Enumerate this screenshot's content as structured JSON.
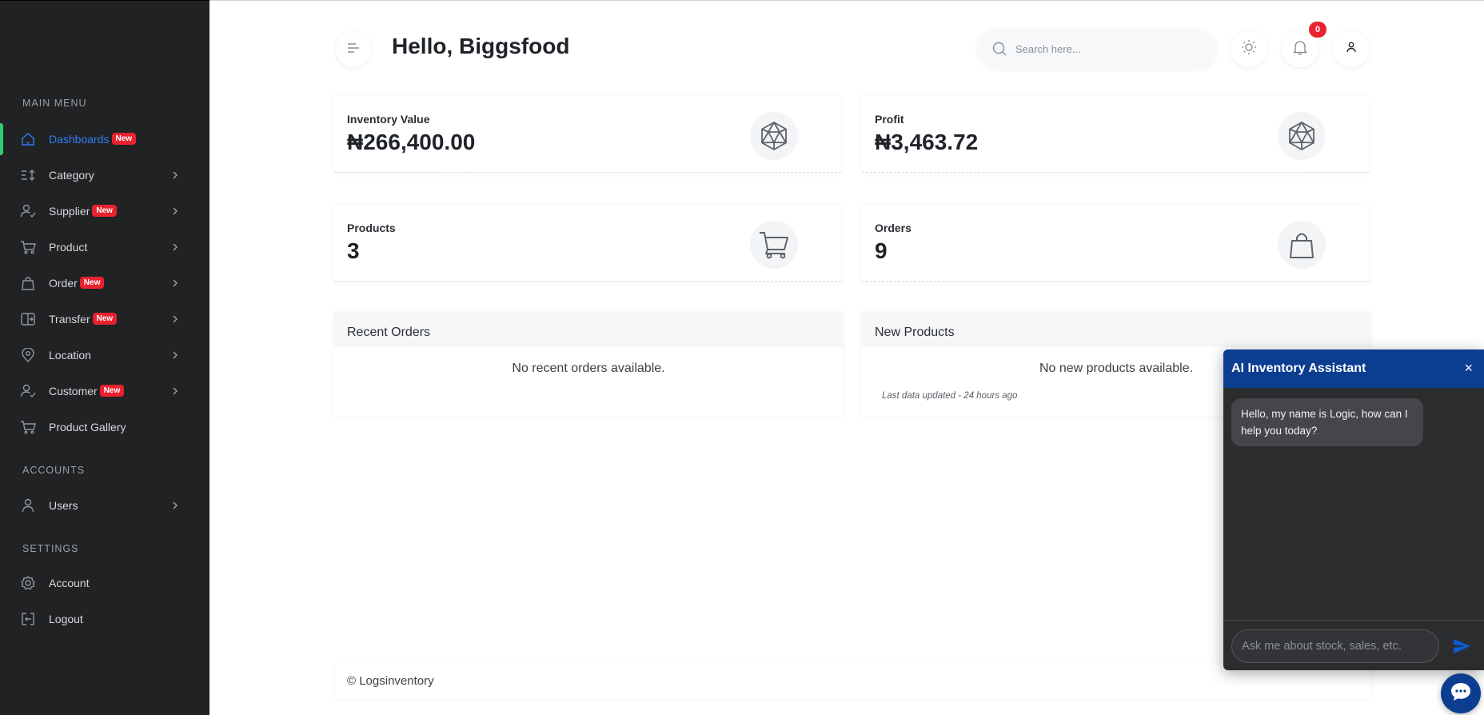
{
  "sidebar": {
    "sections": {
      "main_menu": "MAIN MENU",
      "accounts": "ACCOUNTS",
      "settings": "SETTINGS"
    },
    "items": [
      {
        "label": "Dashboards",
        "badge": "New",
        "icon": "home-icon"
      },
      {
        "label": "Category",
        "icon": "sort-icon"
      },
      {
        "label": "Supplier",
        "badge": "New",
        "icon": "user-check-icon"
      },
      {
        "label": "Product",
        "icon": "cart-icon"
      },
      {
        "label": "Order",
        "badge": "New",
        "icon": "bag-icon"
      },
      {
        "label": "Transfer",
        "badge": "New",
        "icon": "transfer-icon"
      },
      {
        "label": "Location",
        "icon": "location-pin-icon"
      },
      {
        "label": "Customer",
        "badge": "New",
        "icon": "user-check-icon"
      },
      {
        "label": "Product Gallery",
        "icon": "cart-icon"
      },
      {
        "label": "Users",
        "icon": "user-icon"
      },
      {
        "label": "Account",
        "icon": "gear-icon"
      },
      {
        "label": "Logout",
        "icon": "logout-icon"
      }
    ]
  },
  "header": {
    "title": "Hello, Biggsfood",
    "search_placeholder": "Search here...",
    "notification_count": "0"
  },
  "stats": [
    {
      "label": "Inventory Value",
      "value": "₦266,400.00",
      "icon": "icosahedron-icon"
    },
    {
      "label": "Profit",
      "value": "₦3,463.72",
      "icon": "icosahedron-icon"
    },
    {
      "label": "Products",
      "value": "3",
      "icon": "cart-icon"
    },
    {
      "label": "Orders",
      "value": "9",
      "icon": "bag-icon"
    }
  ],
  "panels": {
    "recent_orders": {
      "title": "Recent Orders",
      "empty": "No recent orders available."
    },
    "new_products": {
      "title": "New Products",
      "empty": "No new products available.",
      "meta": "Last data updated - 24 hours ago"
    }
  },
  "footer": {
    "copyright": "© Logsinventory"
  },
  "chat": {
    "title": "AI Inventory Assistant",
    "close_label": "×",
    "greeting": "Hello, my name is Logic, how can I help you today?",
    "input_placeholder": "Ask me about stock, sales, etc."
  },
  "colors": {
    "sidebar_bg": "#212223",
    "active_accent": "#2f7df6",
    "active_bar": "#2ecc71",
    "badge_red": "#e8222f",
    "chat_header": "#0b3d91"
  }
}
